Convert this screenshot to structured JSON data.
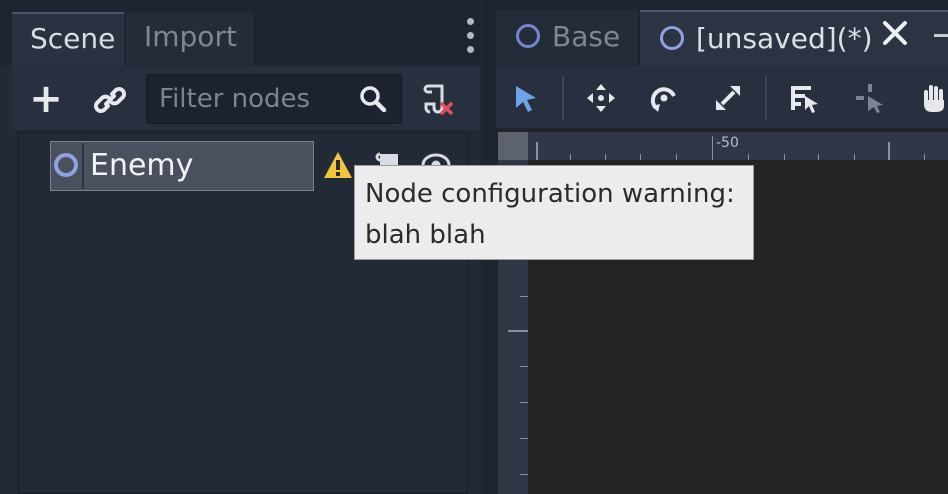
{
  "scene_dock": {
    "tabs": [
      {
        "label": "Scene",
        "active": true
      },
      {
        "label": "Import",
        "active": false
      }
    ],
    "toolbar": {
      "add_icon": "plus-icon",
      "link_icon": "link-icon",
      "filter_placeholder": "Filter nodes",
      "search_icon": "search-icon",
      "script_remove_icon": "script-remove-icon"
    },
    "tree": {
      "nodes": [
        {
          "name": "Enemy",
          "icon": "node-circle-icon",
          "selected": true,
          "has_warning": true
        }
      ]
    }
  },
  "editor": {
    "tabs": [
      {
        "label": "Base",
        "active": false
      },
      {
        "label": "[unsaved](*)",
        "active": true
      }
    ],
    "toolbar_icons": [
      "select-arrow-icon",
      "move-icon",
      "rotate-icon",
      "scale-icon",
      "list-select-icon",
      "pivot-icon",
      "pan-hand-icon"
    ],
    "ruler_label": "-50"
  },
  "tooltip": {
    "text": "Node configuration warning:\nblah blah"
  },
  "colors": {
    "node_icon": "#8fa3e3",
    "warning": "#f2c53d",
    "select_tool": "#6ea2e8",
    "remove": "#e4505a"
  }
}
